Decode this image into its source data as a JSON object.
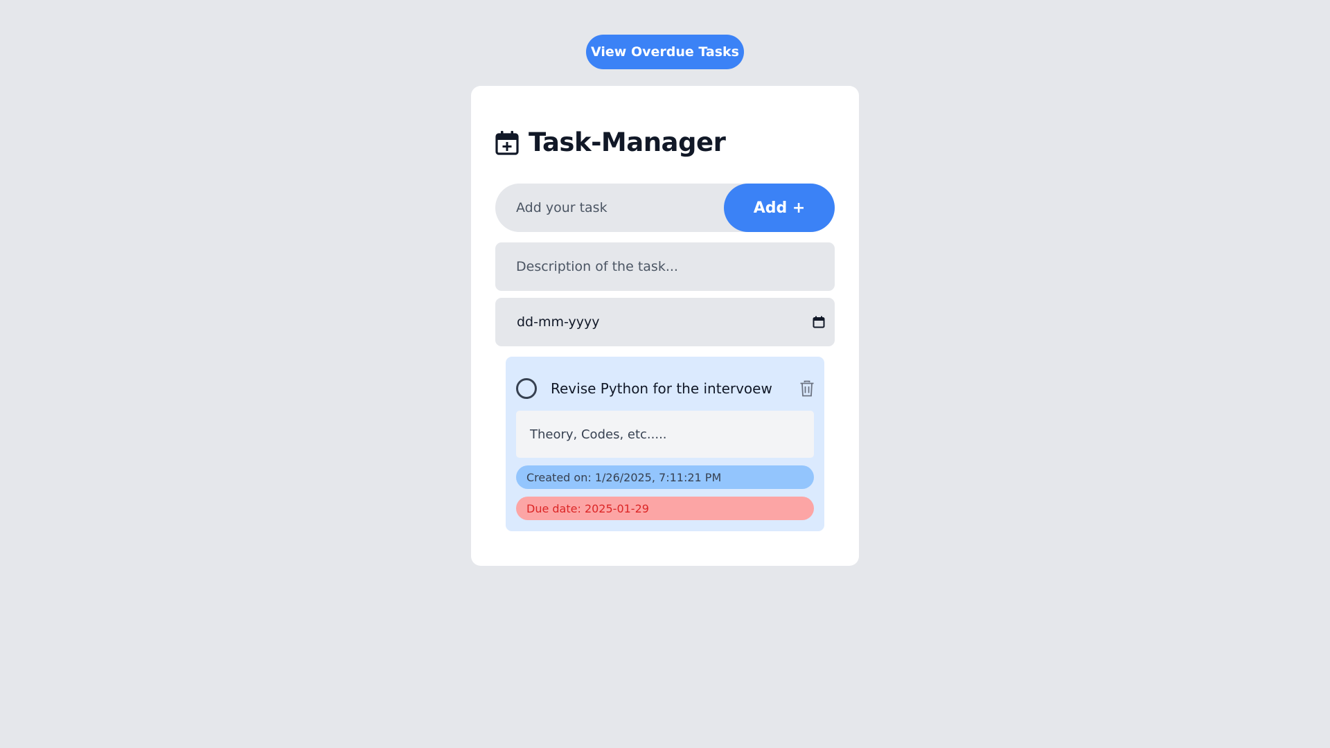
{
  "header": {
    "overdue_button_label": "View Overdue Tasks"
  },
  "app": {
    "title": "Task-Manager",
    "title_icon": "calendar-plus-icon"
  },
  "form": {
    "task_placeholder": "Add your task",
    "add_button_label": "Add +",
    "description_placeholder": "Description of the task...",
    "date_placeholder": "dd-mm-yyyy",
    "date_icon": "calendar-icon"
  },
  "tasks": [
    {
      "title": "Revise Python for the intervoew",
      "description": "Theory, Codes, etc.....",
      "created": "Created on: 1/26/2025, 7:11:21 PM",
      "due": "Due date: 2025-01-29",
      "completed": false
    }
  ],
  "colors": {
    "accent": "#3b82f6",
    "page_bg": "#e5e7eb",
    "task_card_bg": "#dbeafe",
    "created_pill": "#93c5fd",
    "due_pill": "#fca5a5",
    "due_text": "#dc2626"
  }
}
